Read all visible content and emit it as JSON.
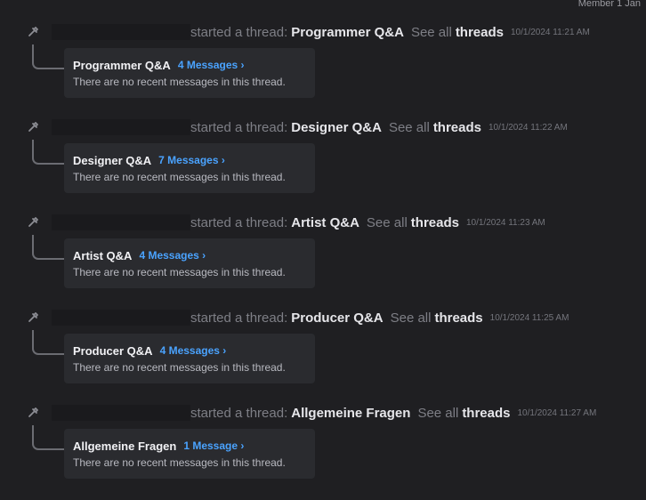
{
  "top_right_text": "Member 1 Jan",
  "threads": [
    {
      "started_text": "started a thread:",
      "thread_title": "Programmer Q&A",
      "see_all_text": "See all",
      "threads_link": "threads",
      "timestamp": "10/1/2024 11:21 AM",
      "card_title": "Programmer Q&A",
      "message_count": "4 Messages ›",
      "body": "There are no recent messages in this thread."
    },
    {
      "started_text": "started a thread:",
      "thread_title": "Designer Q&A",
      "see_all_text": "See all",
      "threads_link": "threads",
      "timestamp": "10/1/2024 11:22 AM",
      "card_title": "Designer Q&A",
      "message_count": "7 Messages ›",
      "body": "There are no recent messages in this thread."
    },
    {
      "started_text": "started a thread:",
      "thread_title": "Artist Q&A",
      "see_all_text": "See all",
      "threads_link": "threads",
      "timestamp": "10/1/2024 11:23 AM",
      "card_title": "Artist Q&A",
      "message_count": "4 Messages ›",
      "body": "There are no recent messages in this thread."
    },
    {
      "started_text": "started a thread:",
      "thread_title": "Producer Q&A",
      "see_all_text": "See all",
      "threads_link": "threads",
      "timestamp": "10/1/2024 11:25 AM",
      "card_title": "Producer Q&A",
      "message_count": "4 Messages ›",
      "body": "There are no recent messages in this thread."
    },
    {
      "started_text": "started a thread:",
      "thread_title": "Allgemeine Fragen",
      "see_all_text": "See all",
      "threads_link": "threads",
      "timestamp": "10/1/2024 11:27 AM",
      "card_title": "Allgemeine Fragen",
      "message_count": "1 Message ›",
      "body": "There are no recent messages in this thread."
    }
  ]
}
